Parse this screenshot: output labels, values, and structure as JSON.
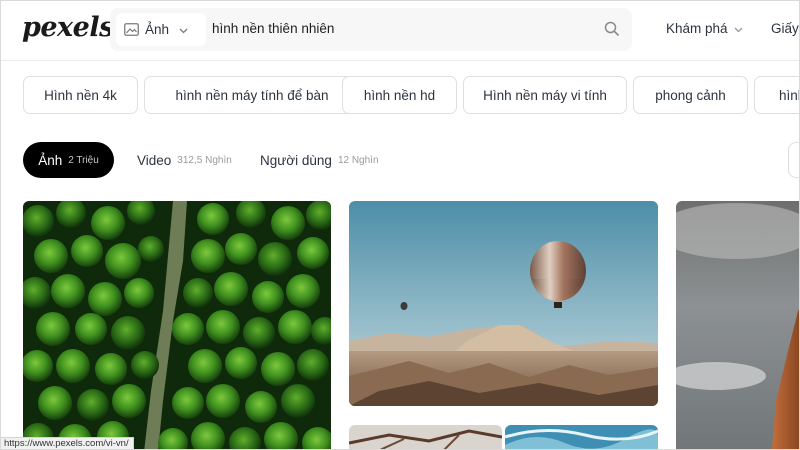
{
  "header": {
    "logo": "pexels",
    "search": {
      "type_label": "Ảnh",
      "query": "hình nền thiên nhiên"
    },
    "nav_explore": "Khám phá",
    "nav_license": "Giấy"
  },
  "chips": [
    "Hình nền 4k",
    "hình nền máy tính để bàn",
    "hình nền hd",
    "Hình nền máy vi tính",
    "phong cảnh",
    "hình"
  ],
  "tabs": {
    "photos": {
      "label": "Ảnh",
      "count": "2 Triệu"
    },
    "videos": {
      "label": "Video",
      "count": "312,5 Nghìn"
    },
    "users": {
      "label": "Người dùng",
      "count": "12 Nghìn"
    }
  },
  "photos": [
    {
      "icon": "forest-aerial-photo"
    },
    {
      "icon": "hot-air-balloon-photo"
    },
    {
      "icon": "rock-sky-photo"
    },
    {
      "icon": "branches-photo"
    },
    {
      "icon": "ocean-wave-photo"
    }
  ],
  "status_bar": {
    "url": "https://www.pexels.com/vi-vn/"
  },
  "colors": {
    "active_tab_bg": "#000000",
    "search_bg": "#f7f7f7",
    "chip_border": "#dfdfe0",
    "text": "#2c343e"
  }
}
